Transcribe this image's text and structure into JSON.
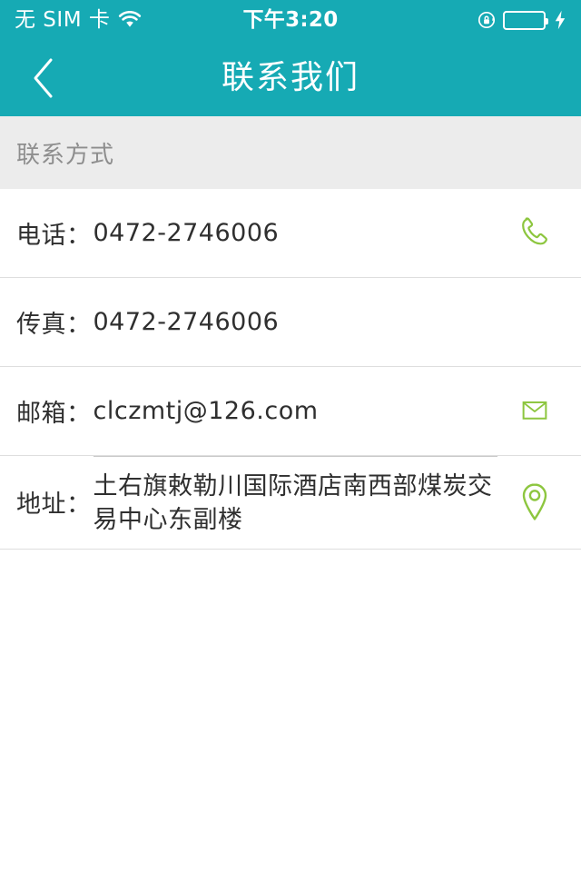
{
  "status_bar": {
    "carrier": "无 SIM 卡",
    "wifi_icon": "wifi-icon",
    "time": "下午3:20",
    "rotation_lock_icon": "rotation-lock-icon",
    "battery_icon": "battery-icon",
    "charging_icon": "lightning-bolt-icon",
    "battery_color": "#5ade70",
    "background_color": "#16aab4"
  },
  "navbar": {
    "back_icon": "chevron-left-icon",
    "title": "联系我们",
    "background_color": "#16aab4",
    "text_color": "#ffffff"
  },
  "section": {
    "header": "联系方式",
    "background_color": "#ececec",
    "text_color": "#8e8e8e"
  },
  "icon_accent_color": "#8dc63f",
  "rows": [
    {
      "label": "电话：",
      "value": "0472-2746006",
      "icon": "phone-handset-icon"
    },
    {
      "label": "传真：",
      "value": "0472-2746006",
      "icon": ""
    },
    {
      "label": "邮箱：",
      "value": "clczmtj@126.com",
      "icon": "envelope-icon"
    },
    {
      "label": "地址：",
      "value": "土右旗敕勒川国际酒店南西部煤炭交易中心东副楼",
      "icon": "map-pin-icon"
    }
  ]
}
